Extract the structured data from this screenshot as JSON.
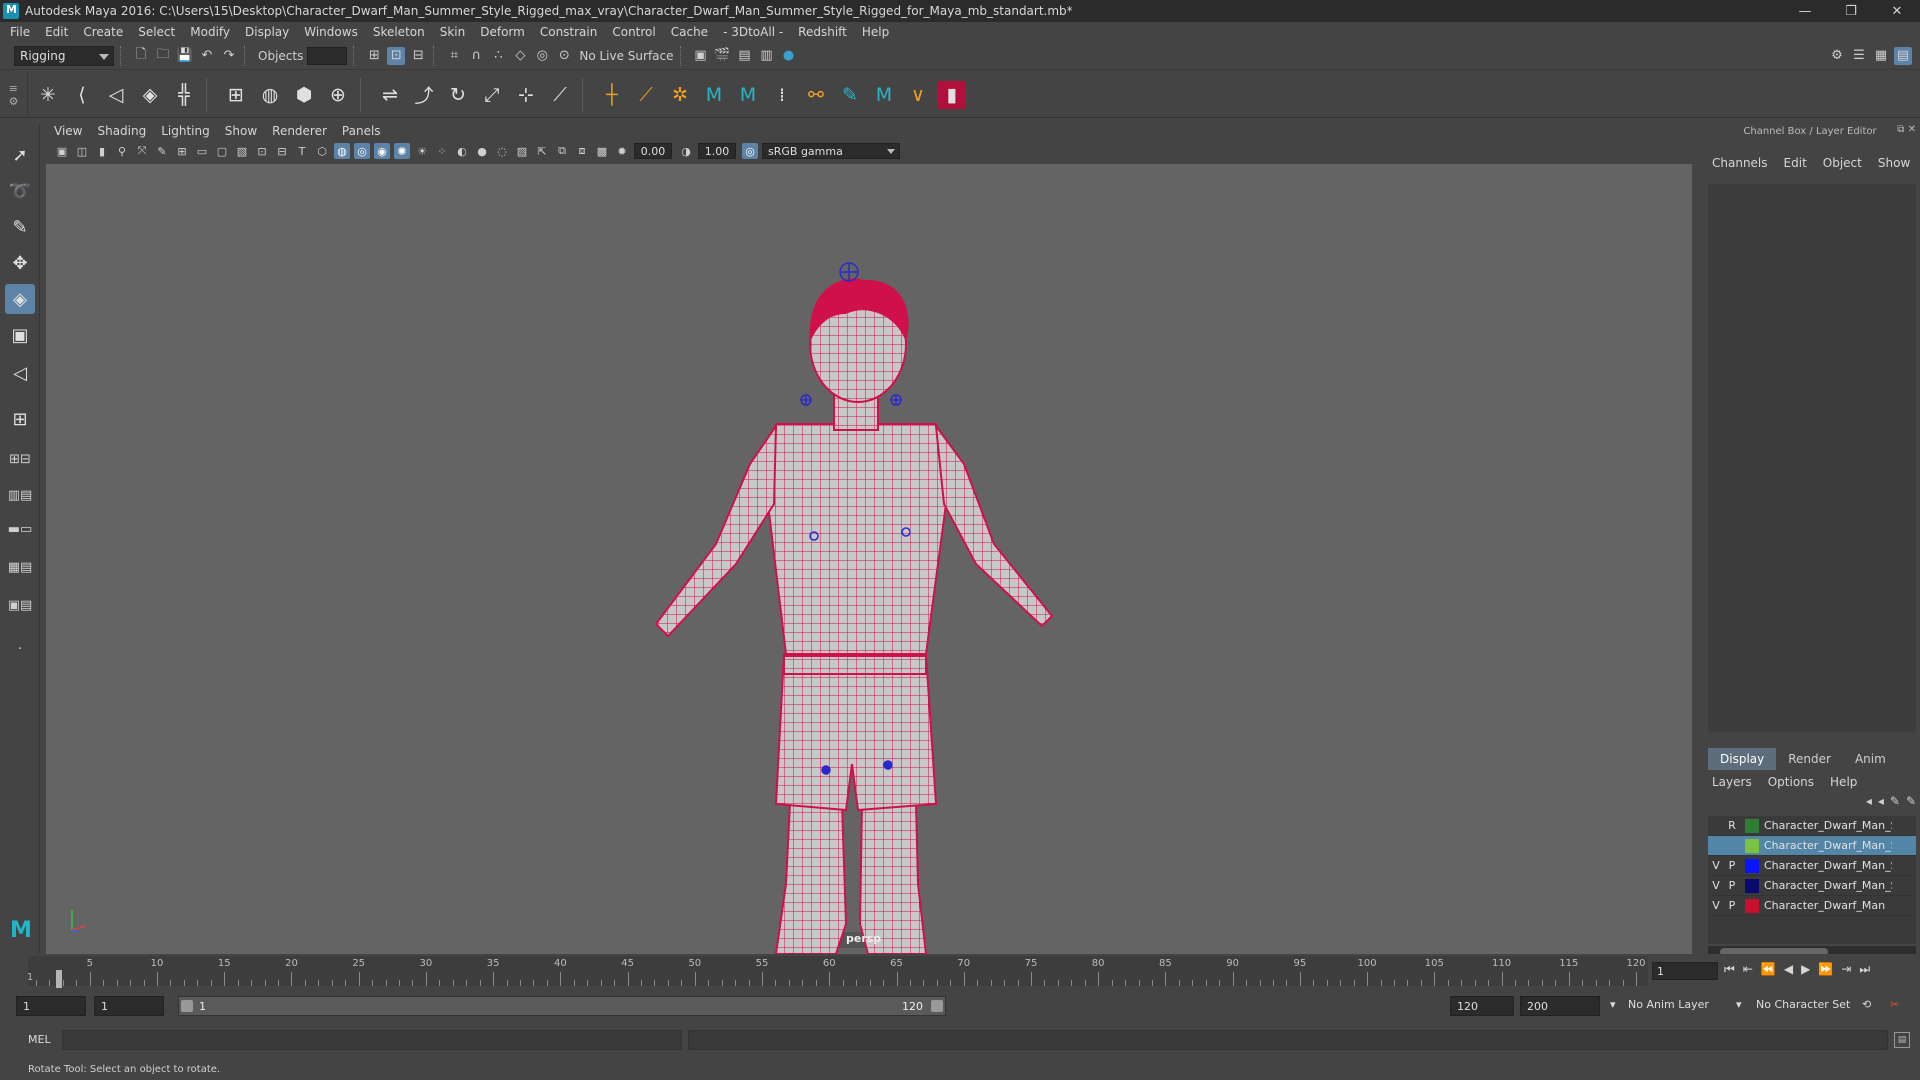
{
  "window": {
    "title": "Autodesk Maya 2016: C:\\Users\\15\\Desktop\\Character_Dwarf_Man_Summer_Style_Rigged_max_vray\\Character_Dwarf_Man_Summer_Style_Rigged_for_Maya_mb_standart.mb*",
    "minimize": "—",
    "maximize": "❐",
    "close": "✕"
  },
  "menubar": [
    "File",
    "Edit",
    "Create",
    "Select",
    "Modify",
    "Display",
    "Windows",
    "Skeleton",
    "Skin",
    "Deform",
    "Constrain",
    "Control",
    "Cache",
    "- 3DtoAll -",
    "Redshift",
    "Help"
  ],
  "statusline": {
    "mode": "Rigging",
    "selection_mask": "Objects",
    "live_surface": "No Live Surface"
  },
  "viewport": {
    "menu": [
      "View",
      "Shading",
      "Lighting",
      "Show",
      "Renderer",
      "Panels"
    ],
    "exposure": "0.00",
    "gamma": "1.00",
    "color_space": "sRGB gamma",
    "camera": "persp"
  },
  "channel_box": {
    "header": "Channel Box / Layer Editor",
    "tabs": [
      "Channels",
      "Edit",
      "Object",
      "Show"
    ]
  },
  "layer_editor": {
    "tabs": [
      "Display",
      "Render",
      "Anim"
    ],
    "active_tab": "Display",
    "menu": [
      "Layers",
      "Options",
      "Help"
    ],
    "layers": [
      {
        "v": "",
        "p": "R",
        "color": "#2e7d32",
        "name": "Character_Dwarf_Man_Summ"
      },
      {
        "v": "",
        "p": "",
        "color": "#7cc242",
        "name": "Character_Dwarf_Man_Summ"
      },
      {
        "v": "V",
        "p": "P",
        "color": "#0a14ff",
        "name": "Character_Dwarf_Man_Su"
      },
      {
        "v": "V",
        "p": "P",
        "color": "#0a0a6e",
        "name": "Character_Dwarf_Man_S"
      },
      {
        "v": "V",
        "p": "P",
        "color": "#c8102e",
        "name": "Character_Dwarf_Man"
      }
    ]
  },
  "timeline": {
    "ticks": [
      "5",
      "10",
      "15",
      "20",
      "25",
      "30",
      "35",
      "40",
      "45",
      "50",
      "55",
      "60",
      "65",
      "70",
      "75",
      "80",
      "85",
      "90",
      "95",
      "100",
      "105",
      "110",
      "115",
      "120"
    ],
    "start_label": "1",
    "current_frame": "1"
  },
  "range": {
    "start": "1",
    "playback_start": "1",
    "bar_start": "1",
    "bar_end": "120",
    "playback_end": "120",
    "end": "200",
    "anim_layer": "No Anim Layer",
    "character_set": "No Character Set"
  },
  "command": {
    "label": "MEL"
  },
  "help_line": "Rotate Tool: Select an object to rotate.",
  "colors": {
    "wireframe": "#d0104a",
    "accent": "#5d84a6",
    "viewport_bg": "#646464"
  }
}
